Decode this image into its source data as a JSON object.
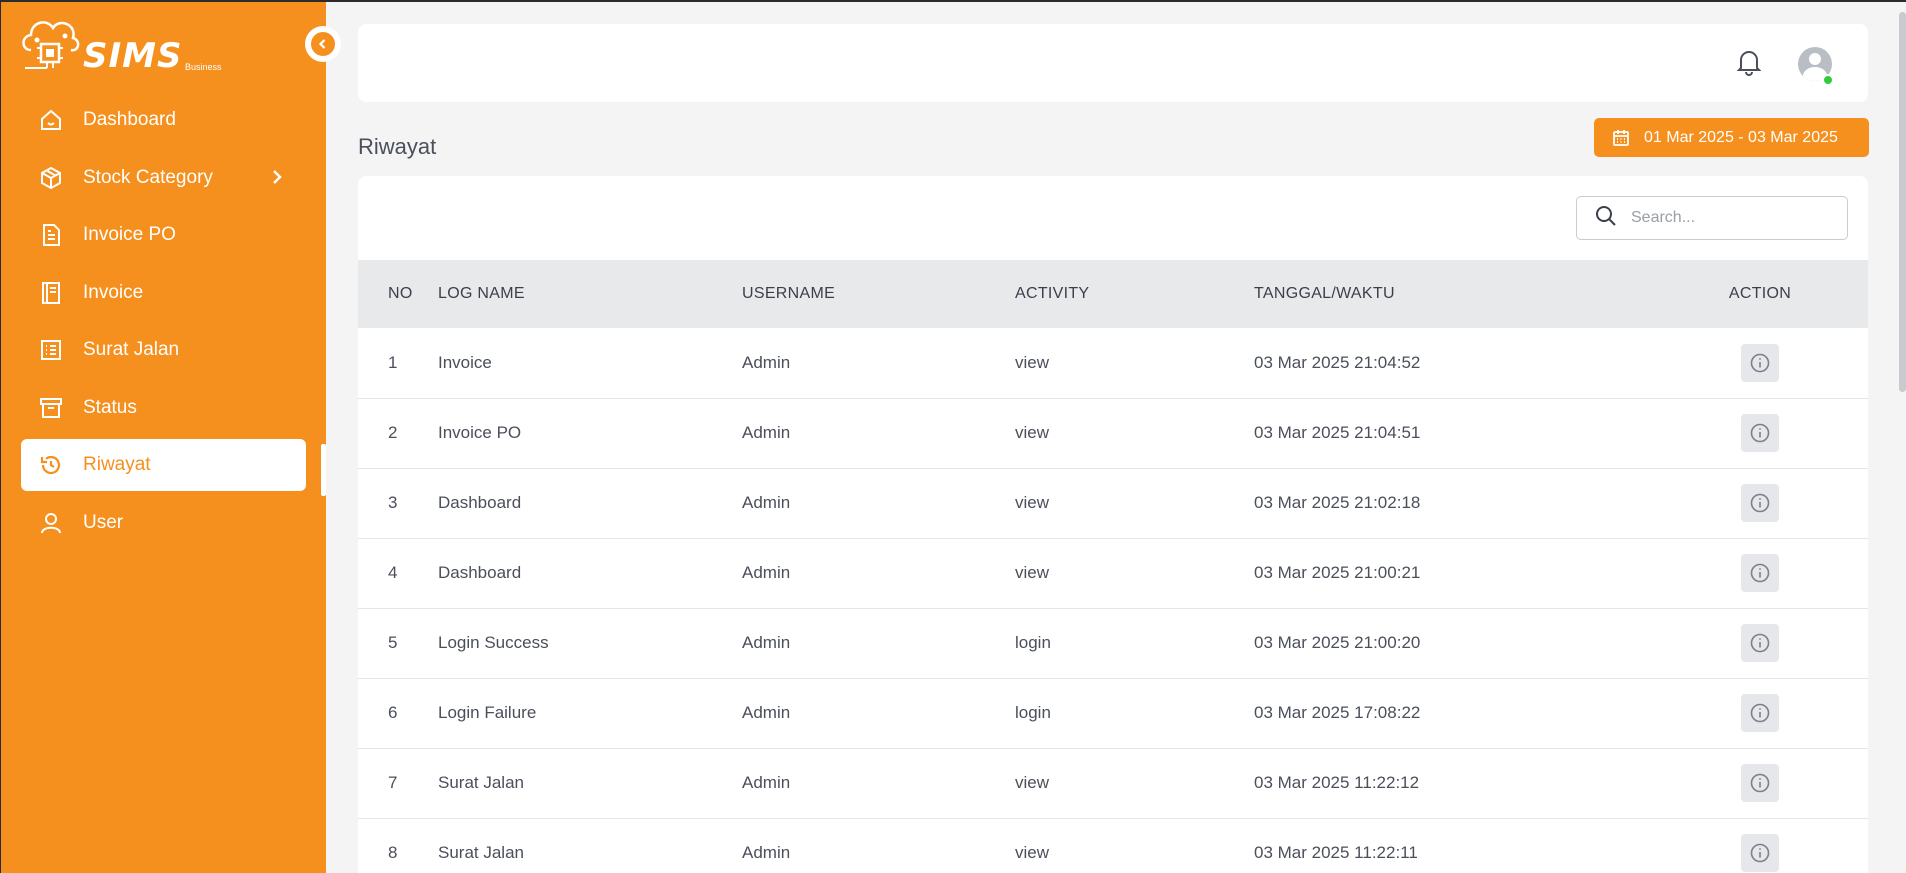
{
  "brand": {
    "name": "SIMS",
    "sub": "Business"
  },
  "sidebar": {
    "items": [
      {
        "label": "Dashboard",
        "icon": "home-icon"
      },
      {
        "label": "Stock Category",
        "icon": "box-icon"
      },
      {
        "label": "Invoice PO",
        "icon": "document-icon"
      },
      {
        "label": "Invoice",
        "icon": "book-icon"
      },
      {
        "label": "Surat Jalan",
        "icon": "list-icon"
      },
      {
        "label": "Status",
        "icon": "archive-icon"
      },
      {
        "label": "Riwayat",
        "icon": "history-icon",
        "active": true
      },
      {
        "label": "User",
        "icon": "user-icon"
      }
    ]
  },
  "page": {
    "title": "Riwayat",
    "date_range": "01 Mar 2025 - 03 Mar 2025"
  },
  "search": {
    "placeholder": "Search..."
  },
  "table": {
    "headers": [
      "NO",
      "LOG NAME",
      "USERNAME",
      "ACTIVITY",
      "TANGGAL/WAKTU",
      "ACTION"
    ],
    "rows": [
      [
        "1",
        "Invoice",
        "Admin",
        "view",
        "03 Mar 2025 21:04:52"
      ],
      [
        "2",
        "Invoice PO",
        "Admin",
        "view",
        "03 Mar 2025 21:04:51"
      ],
      [
        "3",
        "Dashboard",
        "Admin",
        "view",
        "03 Mar 2025 21:02:18"
      ],
      [
        "4",
        "Dashboard",
        "Admin",
        "view",
        "03 Mar 2025 21:00:21"
      ],
      [
        "5",
        "Login Success",
        "Admin",
        "login",
        "03 Mar 2025 21:00:20"
      ],
      [
        "6",
        "Login Failure",
        "Admin",
        "login",
        "03 Mar 2025 17:08:22"
      ],
      [
        "7",
        "Surat Jalan",
        "Admin",
        "view",
        "03 Mar 2025 11:22:12"
      ],
      [
        "8",
        "Surat Jalan",
        "Admin",
        "view",
        "03 Mar 2025 11:22:11"
      ]
    ]
  },
  "colors": {
    "accent": "#f5901e",
    "online": "#2ecc40",
    "header_bg": "#e8e9eb"
  }
}
